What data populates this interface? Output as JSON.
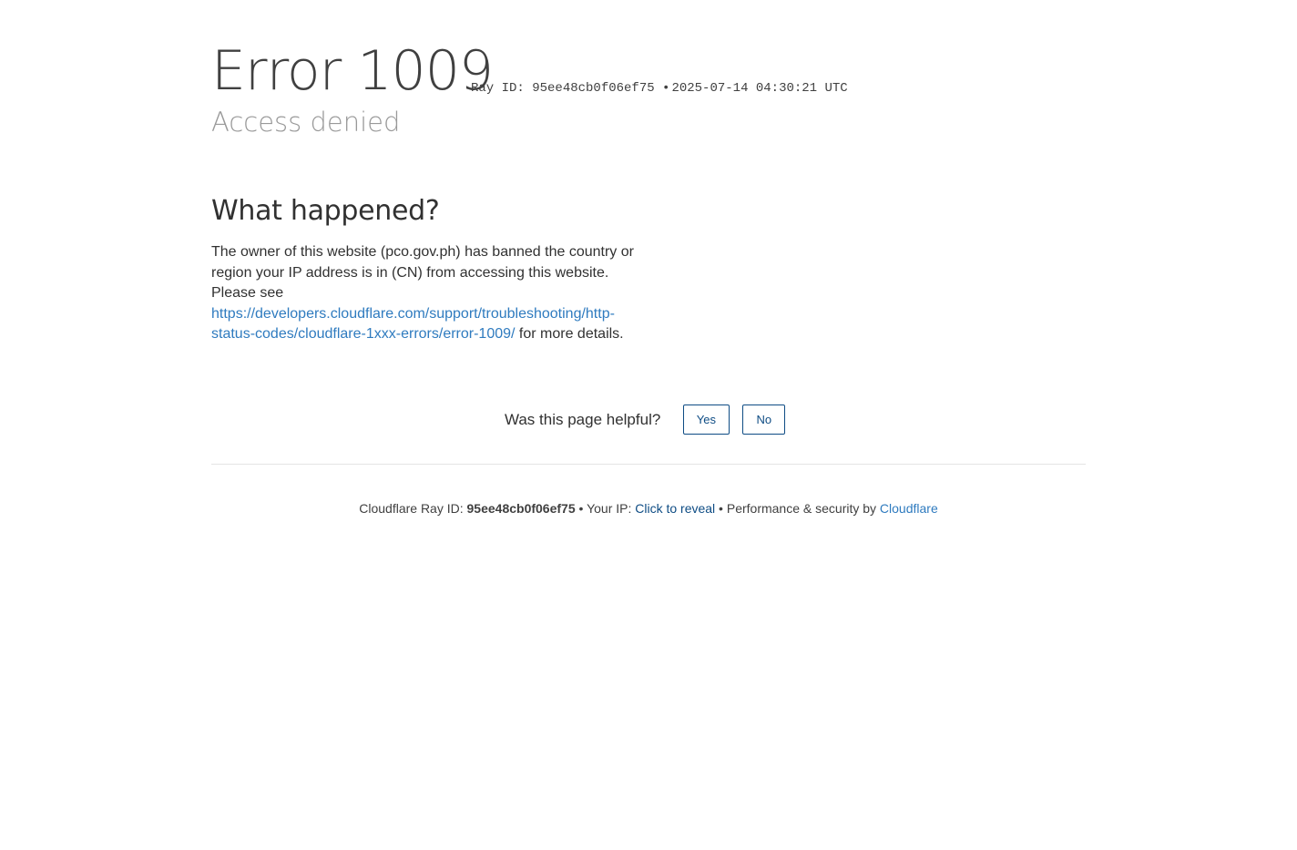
{
  "header": {
    "error_code": "Error 1009",
    "ray_id_label": "Ray ID: 95ee48cb0f06ef75",
    "bullet": "•",
    "timestamp": "2025-07-14 04:30:21 UTC",
    "subtitle": "Access denied"
  },
  "what_happened": {
    "heading": "What happened?",
    "text_before_link": "The owner of this website (pco.gov.ph) has banned the country or region your IP address is in (CN) from accessing this website. Please see ",
    "link_text": "https://developers.cloudflare.com/support/troubleshooting/http-status-codes/cloudflare-1xxx-errors/error-1009/",
    "text_after_link": " for more details."
  },
  "feedback": {
    "question": "Was this page helpful?",
    "yes_label": "Yes",
    "no_label": "No"
  },
  "footer": {
    "ray_label": "Cloudflare Ray ID: ",
    "ray_id": "95ee48cb0f06ef75",
    "sep1": " • ",
    "ip_label": "Your IP: ",
    "ip_link": "Click to reveal",
    "sep2": " • ",
    "perf_label": "Performance & security by ",
    "cloudflare_link": "Cloudflare"
  },
  "colors": {
    "link": "#2f7bbf",
    "button_border": "#0e4c84",
    "subtitle": "#999999"
  }
}
